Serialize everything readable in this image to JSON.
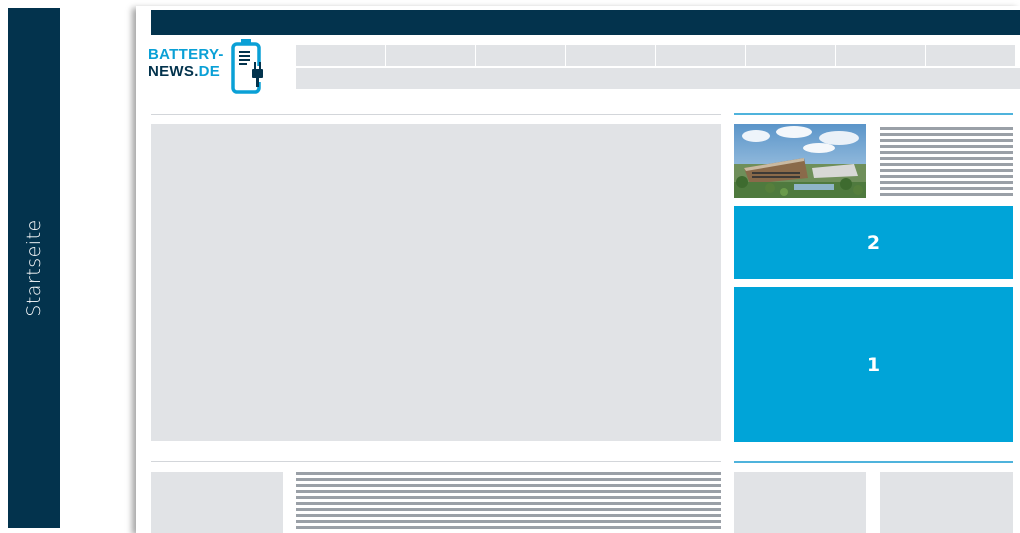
{
  "side_tab": {
    "label": "Startseite"
  },
  "logo": {
    "line1": "BATTERY-",
    "line2_main": "NEWS.",
    "line2_accent": "DE"
  },
  "ad_slots": [
    {
      "label": "2"
    },
    {
      "label": "1"
    }
  ],
  "colors": {
    "navy": "#03334d",
    "accent": "#00a4d8",
    "placeholder": "#e1e3e6",
    "text_line": "#9aa0a7"
  }
}
